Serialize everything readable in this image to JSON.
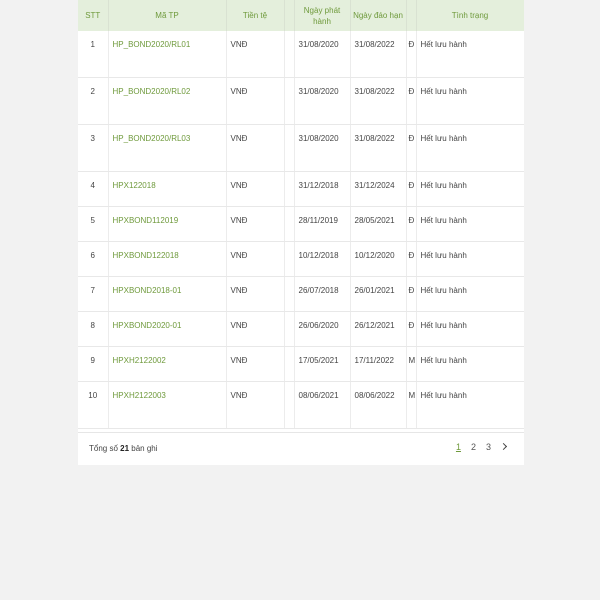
{
  "table": {
    "headers": {
      "stt": "STT",
      "code": "Mã TP",
      "currency": "Tiền tệ",
      "issue_date": "Ngày phát hành",
      "maturity_date": "Ngày đáo hạn",
      "status": "Tình trạng"
    },
    "rows": [
      {
        "stt": "1",
        "code": "HP_BOND2020/RL01",
        "currency": "VNĐ",
        "issue": "31/08/2020",
        "maturity": "31/08/2022",
        "flag": "Đ",
        "status": "Hết lưu hành"
      },
      {
        "stt": "2",
        "code": "HP_BOND2020/RL02",
        "currency": "VNĐ",
        "issue": "31/08/2020",
        "maturity": "31/08/2022",
        "flag": "Đ",
        "status": "Hết lưu hành"
      },
      {
        "stt": "3",
        "code": "HP_BOND2020/RL03",
        "currency": "VNĐ",
        "issue": "31/08/2020",
        "maturity": "31/08/2022",
        "flag": "Đ",
        "status": "Hết lưu hành"
      },
      {
        "stt": "4",
        "code": "HPX122018",
        "currency": "VNĐ",
        "issue": "31/12/2018",
        "maturity": "31/12/2024",
        "flag": "Đ",
        "status": "Hết lưu hành"
      },
      {
        "stt": "5",
        "code": "HPXBOND112019",
        "currency": "VNĐ",
        "issue": "28/11/2019",
        "maturity": "28/05/2021",
        "flag": "Đ",
        "status": "Hết lưu hành"
      },
      {
        "stt": "6",
        "code": "HPXBOND122018",
        "currency": "VNĐ",
        "issue": "10/12/2018",
        "maturity": "10/12/2020",
        "flag": "Đ",
        "status": "Hết lưu hành"
      },
      {
        "stt": "7",
        "code": "HPXBOND2018-01",
        "currency": "VNĐ",
        "issue": "26/07/2018",
        "maturity": "26/01/2021",
        "flag": "Đ",
        "status": "Hết lưu hành"
      },
      {
        "stt": "8",
        "code": "HPXBOND2020-01",
        "currency": "VNĐ",
        "issue": "26/06/2020",
        "maturity": "26/12/2021",
        "flag": "Đ",
        "status": "Hết lưu hành"
      },
      {
        "stt": "9",
        "code": "HPXH2122002",
        "currency": "VNĐ",
        "issue": "17/05/2021",
        "maturity": "17/11/2022",
        "flag": "M",
        "status": "Hết lưu hành"
      },
      {
        "stt": "10",
        "code": "HPXH2122003",
        "currency": "VNĐ",
        "issue": "08/06/2021",
        "maturity": "08/06/2022",
        "flag": "M",
        "status": "Hết lưu hành"
      }
    ]
  },
  "footer": {
    "total_prefix": "Tổng số",
    "total_count": "21",
    "total_suffix": "bản ghi"
  },
  "pagination": {
    "pages": [
      "1",
      "2",
      "3"
    ],
    "current": "1",
    "next_icon": "chevron-right-icon"
  },
  "colors": {
    "accent": "#6f9a3c",
    "header_bg": "#e4efdc"
  }
}
